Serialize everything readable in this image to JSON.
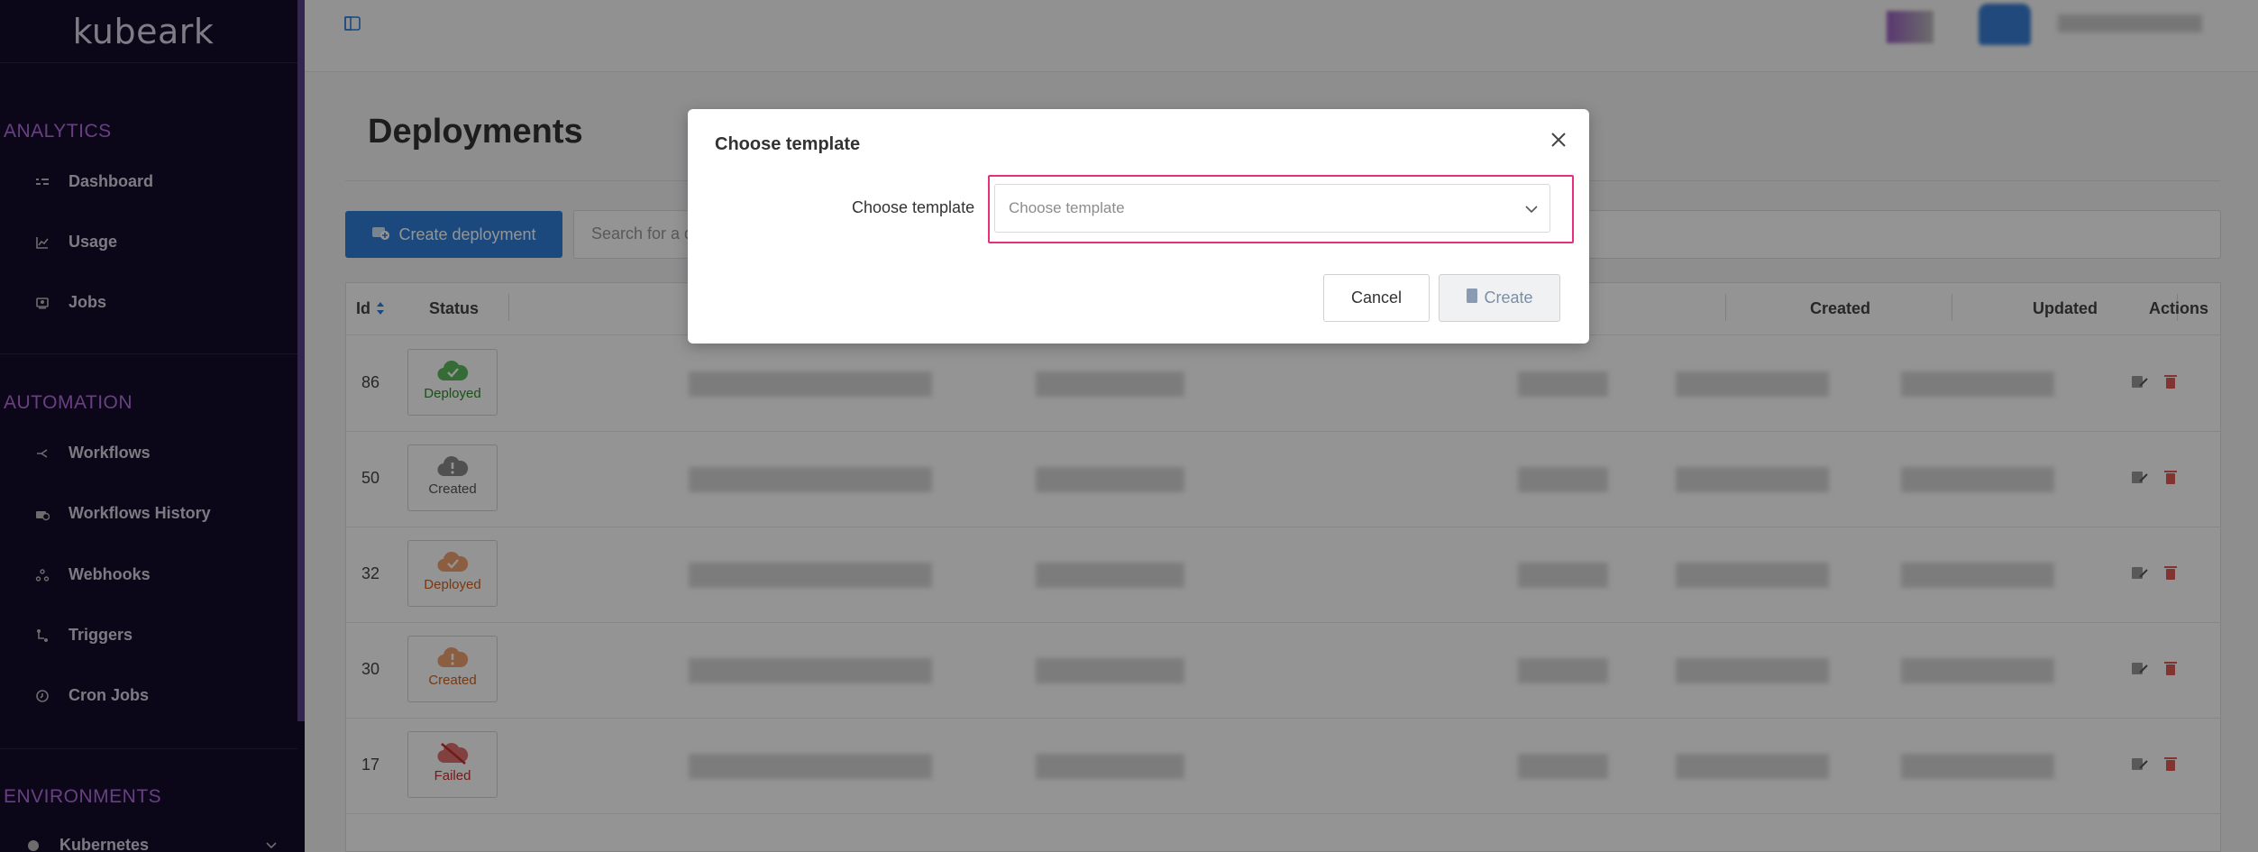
{
  "app": {
    "logo": "kubeark"
  },
  "sidebar": {
    "sections": [
      {
        "title": "ANALYTICS",
        "items": [
          {
            "label": "Dashboard",
            "icon": "dashboard-icon"
          },
          {
            "label": "Usage",
            "icon": "chart-icon"
          },
          {
            "label": "Jobs",
            "icon": "jobs-icon"
          }
        ]
      },
      {
        "title": "AUTOMATION",
        "items": [
          {
            "label": "Workflows",
            "icon": "workflow-icon"
          },
          {
            "label": "Workflows History",
            "icon": "history-icon"
          },
          {
            "label": "Webhooks",
            "icon": "webhook-icon"
          },
          {
            "label": "Triggers",
            "icon": "trigger-icon"
          },
          {
            "label": "Cron Jobs",
            "icon": "clock-icon"
          }
        ]
      },
      {
        "title": "ENVIRONMENTS",
        "items": [
          {
            "label": "Kubernetes",
            "icon": "kubernetes-icon"
          }
        ]
      }
    ]
  },
  "main": {
    "title": "Deployments",
    "create_button": "Create deployment",
    "search_placeholder": "Search for a d",
    "table": {
      "headers": {
        "id": "Id",
        "status": "Status",
        "created": "Created",
        "updated": "Updated",
        "actions": "Actions"
      },
      "rows": [
        {
          "id": "86",
          "status": "Deployed",
          "status_color": "#2e8b2e",
          "icon_color": "#5cb85c",
          "glyph": "check"
        },
        {
          "id": "50",
          "status": "Created",
          "status_color": "#555555",
          "icon_color": "#8a8a8a",
          "glyph": "exclaim"
        },
        {
          "id": "32",
          "status": "Deployed",
          "status_color": "#d0611c",
          "icon_color": "#f0a070",
          "glyph": "check"
        },
        {
          "id": "30",
          "status": "Created",
          "status_color": "#d0611c",
          "icon_color": "#f0a070",
          "glyph": "exclaim"
        },
        {
          "id": "17",
          "status": "Failed",
          "status_color": "#c9302c",
          "icon_color": "#e07070",
          "glyph": "slash"
        }
      ]
    }
  },
  "modal": {
    "title": "Choose template",
    "field_label": "Choose template",
    "select_placeholder": "Choose template",
    "cancel_label": "Cancel",
    "create_label": "Create"
  },
  "colors": {
    "accent": "#2f7fd8",
    "highlight": "#e6307f",
    "sidebar_bg": "#150b2b",
    "section_title": "#b46fe0"
  }
}
